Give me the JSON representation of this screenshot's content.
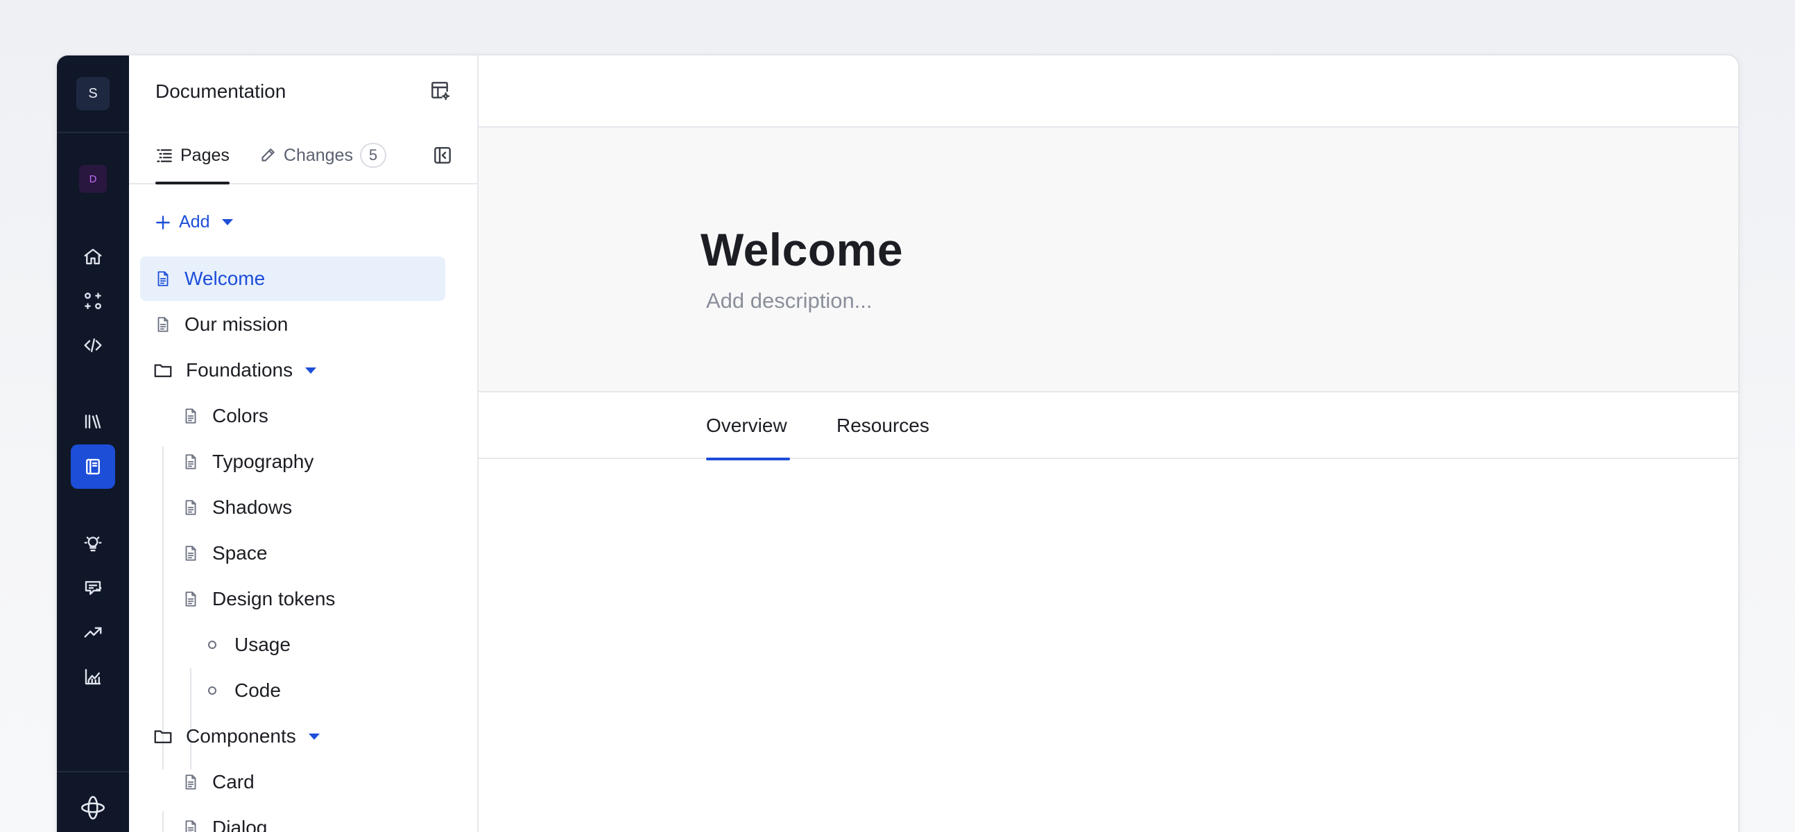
{
  "rail": {
    "workspace_initial": "S",
    "project_initial": "D"
  },
  "sidebar": {
    "title": "Documentation",
    "tabs": [
      {
        "label": "Pages"
      },
      {
        "label": "Changes",
        "count": "5"
      }
    ],
    "add_label": "Add",
    "tree": {
      "welcome": "Welcome",
      "our_mission": "Our mission",
      "foundations": "Foundations",
      "colors": "Colors",
      "typography": "Typography",
      "shadows": "Shadows",
      "space": "Space",
      "design_tokens": "Design tokens",
      "usage": "Usage",
      "code": "Code",
      "components": "Components",
      "card": "Card",
      "dialog": "Dialog"
    }
  },
  "page": {
    "title": "Welcome",
    "description_placeholder": "Add description...",
    "tabs": [
      {
        "label": "Overview"
      },
      {
        "label": "Resources"
      }
    ]
  },
  "colors": {
    "accent": "#1d4ed8",
    "rail_bg": "#0f1729",
    "selected_bg": "#e8f0fc"
  }
}
